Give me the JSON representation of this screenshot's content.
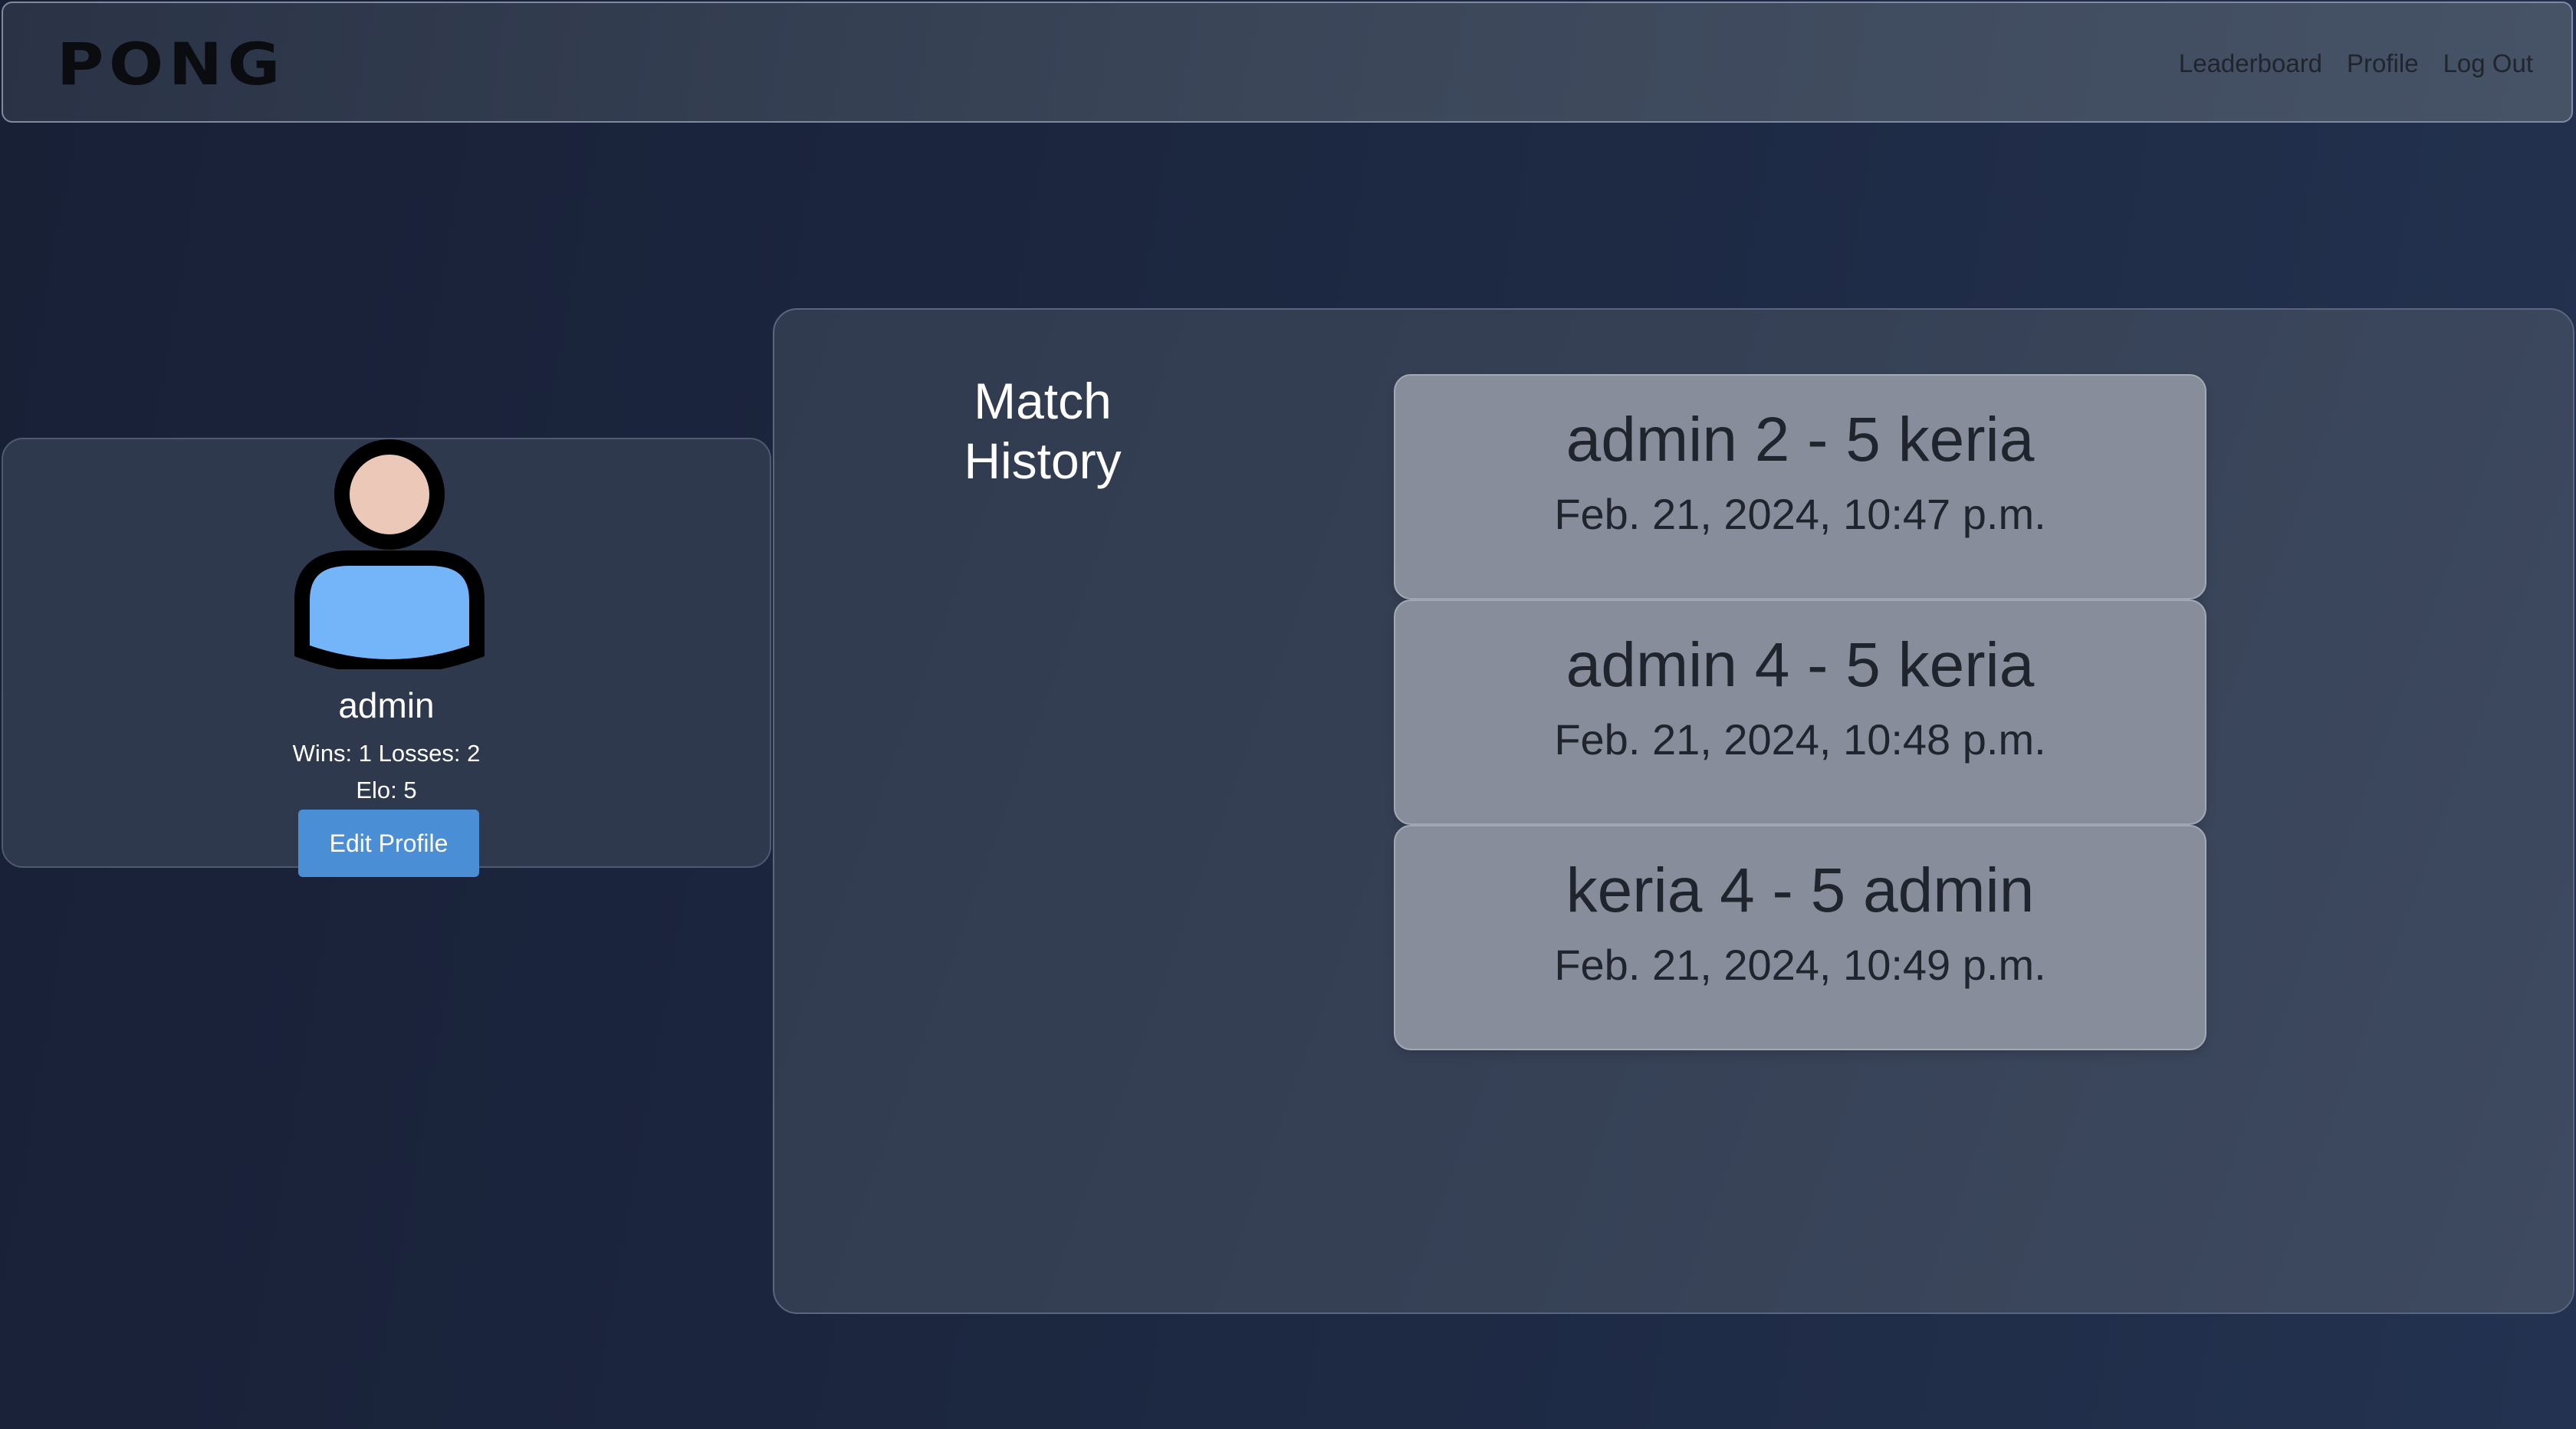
{
  "navbar": {
    "logo_text": "PONG",
    "links": [
      {
        "label": "Leaderboard"
      },
      {
        "label": "Profile"
      },
      {
        "label": "Log Out"
      }
    ]
  },
  "profile": {
    "username": "admin",
    "wins_losses": "Wins: 1 Losses: 2",
    "elo": "Elo: 5",
    "edit_button": "Edit Profile"
  },
  "history": {
    "title_line1": "Match",
    "title_line2": "History",
    "matches": [
      {
        "score": "admin 2 - 5 keria",
        "date": "Feb. 21, 2024, 10:47 p.m."
      },
      {
        "score": "admin 4 - 5 keria",
        "date": "Feb. 21, 2024, 10:48 p.m."
      },
      {
        "score": "keria 4 - 5 admin",
        "date": "Feb. 21, 2024, 10:49 p.m."
      }
    ]
  },
  "colors": {
    "accent_button": "#4a8fd6",
    "avatar_head": "#ecc8b8",
    "avatar_body": "#74b4f8"
  }
}
